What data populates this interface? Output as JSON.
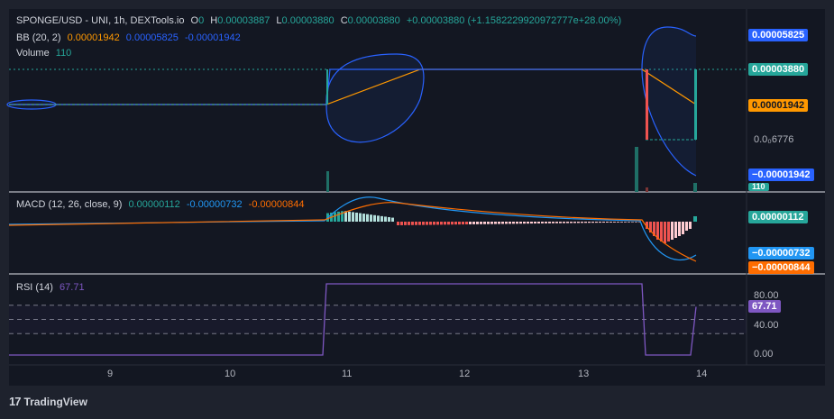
{
  "header": {
    "symbol": "SPONGE/USD - UNI, 1h, DEXTools.io",
    "o_label": "O",
    "o_value": "0",
    "h_label": "H",
    "h_value": "0.00003887",
    "l_label": "L",
    "l_value": "0.00003880",
    "c_label": "C",
    "c_value": "0.00003880",
    "change": "+0.00003880 (+1.1582229920972777e+28.00%)"
  },
  "bb_legend": {
    "label": "BB (20, 2)",
    "basis": "0.00001942",
    "upper": "0.00005825",
    "lower": "-0.00001942"
  },
  "volume_legend": {
    "label": "Volume",
    "value": "110"
  },
  "macd_legend": {
    "label": "MACD (12, 26, close, 9)",
    "hist": "0.00000112",
    "macd": "-0.00000732",
    "signal": "-0.00000844"
  },
  "rsi_legend": {
    "label": "RSI (14)",
    "value": "67.71"
  },
  "price_axis": {
    "upper_badge": "0.00005825",
    "last_badge": "0.00003880",
    "basis_badge": "0.00001942",
    "mid_label": "0.0₀6776",
    "lower_badge": "−0.00001942",
    "volume_badge": "110"
  },
  "macd_axis": {
    "hist_badge": "0.00000112",
    "macd_badge": "−0.00000732",
    "signal_badge": "−0.00000844"
  },
  "rsi_axis": {
    "ticks": [
      "80.00",
      "40.00",
      "0.00"
    ],
    "value_badge": "67.71"
  },
  "time_axis": {
    "ticks": [
      "9",
      "10",
      "11",
      "12",
      "13",
      "14"
    ]
  },
  "brand": {
    "logo": "17",
    "name": "TradingView"
  },
  "colors": {
    "background": "#131722",
    "bb_line": "#2962ff",
    "basis": "#ff9800",
    "up": "#26a69a",
    "down": "#ef5350",
    "macd": "#2196f3",
    "signal": "#ff6d00",
    "rsi": "#7e57c2"
  },
  "chart_data": [
    {
      "type": "line",
      "name": "price_bb",
      "x": [
        8.0,
        8.5,
        10.8,
        10.83,
        11.6,
        13.5,
        13.52,
        13.95
      ],
      "close": [
        1.942e-05,
        1.942e-05,
        1.942e-05,
        3.88e-05,
        3.88e-05,
        3.88e-05,
        0.0,
        3.88e-05
      ],
      "bb_upper_at_latest": 5.825e-05,
      "bb_basis_at_latest": 1.942e-05,
      "bb_lower_at_latest": -1.942e-05,
      "last_price": 3.88e-05
    },
    {
      "type": "bar",
      "name": "volume",
      "latest": 110
    },
    {
      "type": "line",
      "name": "macd",
      "x": [
        8.0,
        10.8,
        11.2,
        11.6,
        12.5,
        13.5,
        13.7,
        13.9,
        13.95
      ],
      "macd": [
        0.0,
        0.0,
        5.5e-06,
        4.5e-06,
        1.2e-06,
        0.0,
        -4e-06,
        -9.5e-06,
        -7.32e-06
      ],
      "signal": [
        0.0,
        0.0,
        3.5e-06,
        3.8e-06,
        1.5e-06,
        0.0,
        -2e-06,
        -8.5e-06,
        -8.44e-06
      ],
      "latest_hist": 1.12e-06
    },
    {
      "type": "line",
      "name": "rsi",
      "x": [
        8.0,
        10.8,
        10.85,
        13.5,
        13.55,
        13.9,
        13.95
      ],
      "values": [
        0,
        0,
        100,
        100,
        0,
        0,
        67.71
      ],
      "ylim": [
        0,
        100
      ],
      "bands": [
        30,
        50,
        70
      ],
      "latest": 67.71
    }
  ]
}
